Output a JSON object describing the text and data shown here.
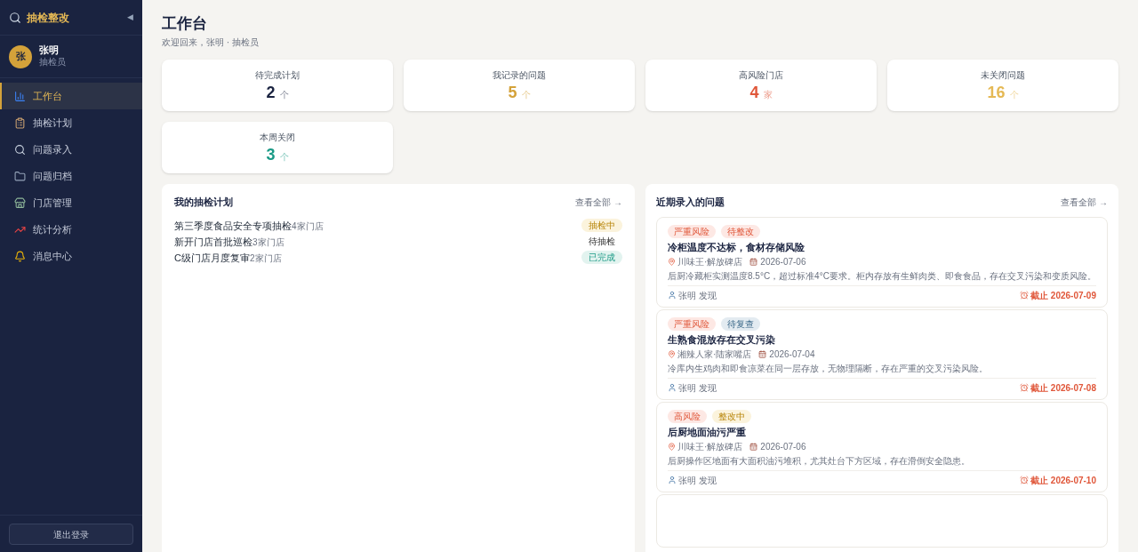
{
  "sidebar": {
    "app_name": "抽检整改",
    "collapse_glyph": "◀",
    "user": {
      "avatar": "张",
      "name": "张明",
      "role": "抽检员"
    },
    "items": [
      {
        "label": "工作台",
        "selected": true
      },
      {
        "label": "抽检计划",
        "selected": false
      },
      {
        "label": "问题录入",
        "selected": false
      },
      {
        "label": "问题归档",
        "selected": false
      },
      {
        "label": "门店管理",
        "selected": false
      },
      {
        "label": "统计分析",
        "selected": false
      },
      {
        "label": "消息中心",
        "selected": false
      }
    ],
    "logout": "退出登录"
  },
  "header": {
    "title": "工作台",
    "subtitle": "欢迎回来，张明 · 抽检员"
  },
  "stats": [
    {
      "label": "待完成计划",
      "value": "2",
      "unit": "个",
      "color": "#1a2340"
    },
    {
      "label": "我记录的问题",
      "value": "5",
      "unit": "个",
      "color": "#d4a23a"
    },
    {
      "label": "高风险门店",
      "value": "4",
      "unit": "家",
      "color": "#e0573a"
    },
    {
      "label": "未关闭问题",
      "value": "16",
      "unit": "个",
      "color": "#e5b955"
    },
    {
      "label": "本周关闭",
      "value": "3",
      "unit": "个",
      "color": "#1a9a86"
    }
  ],
  "plans_panel": {
    "title": "我的抽检计划",
    "view_all": "查看全部 →",
    "plans": [
      {
        "name": "第三季度食品安全专项抽检",
        "stores": "4家门店",
        "status": "抽检中",
        "kind": "active"
      },
      {
        "name": "新开门店首批巡检",
        "stores": "3家门店",
        "status": "待抽检",
        "kind": "pending"
      },
      {
        "name": "C级门店月度复审",
        "stores": "2家门店",
        "status": "已完成",
        "kind": "done"
      }
    ]
  },
  "issues_panel": {
    "title": "近期录入的问题",
    "view_all": "查看全部 →",
    "issues": [
      {
        "tags": [
          {
            "text": "严重风险",
            "kind": "risk"
          },
          {
            "text": "待整改",
            "kind": "todo"
          }
        ],
        "title": "冷柜温度不达标，食材存储风险",
        "store": "川味王·解放碑店",
        "date": "2026-07-06",
        "description": "后厨冷藏柜实测温度8.5°C，超过标准4°C要求。柜内存放有生鲜肉类、即食食品，存在交叉污染和变质风险。",
        "reporter": "张明 发现",
        "deadline": "截止 2026-07-09"
      },
      {
        "tags": [
          {
            "text": "严重风险",
            "kind": "risk"
          },
          {
            "text": "待复查",
            "kind": "review"
          }
        ],
        "title": "生熟食混放存在交叉污染",
        "store": "湘辣人家·陆家嘴店",
        "date": "2026-07-04",
        "description": "冷库内生鸡肉和即食凉菜在同一层存放，无物理隔断，存在严重的交叉污染风险。",
        "reporter": "张明 发现",
        "deadline": "截止 2026-07-08"
      },
      {
        "tags": [
          {
            "text": "高风险",
            "kind": "risk"
          },
          {
            "text": "整改中",
            "kind": "fixing"
          }
        ],
        "title": "后厨地面油污严重",
        "store": "川味王·解放碑店",
        "date": "2026-07-06",
        "description": "后厨操作区地面有大面积油污堆积，尤其灶台下方区域，存在滑倒安全隐患。",
        "reporter": "张明 发现",
        "deadline": "截止 2026-07-10"
      }
    ]
  }
}
